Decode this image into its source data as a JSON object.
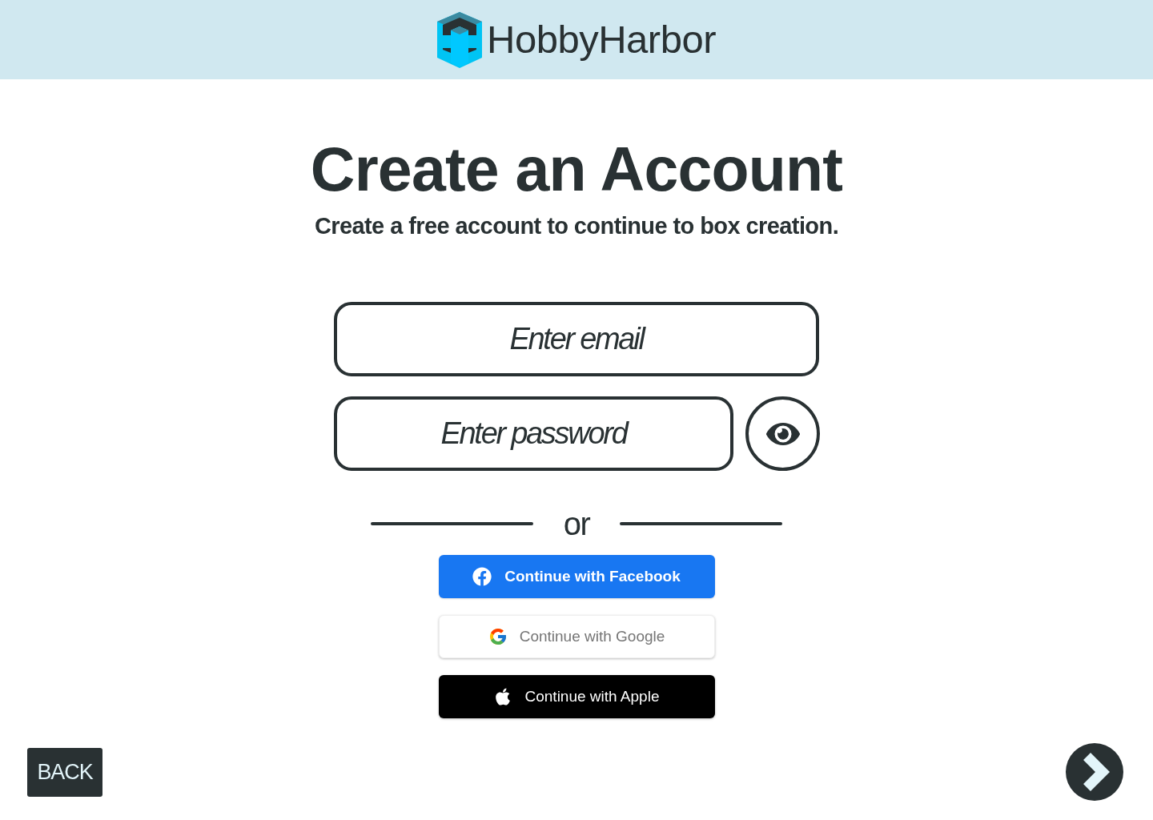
{
  "header": {
    "logo_text": "HobbyHarbor"
  },
  "heading": "Create an Account",
  "subheading": "Create a free account to continue to box creation.",
  "form": {
    "email": {
      "placeholder": "Enter email"
    },
    "password": {
      "placeholder": "Enter password"
    }
  },
  "divider": {
    "text": "or"
  },
  "social_buttons": [
    {
      "kind": "facebook",
      "label": "Continue with Facebook"
    },
    {
      "kind": "google",
      "label": "Continue with Google"
    },
    {
      "kind": "apple",
      "label": "Continue with Apple"
    }
  ],
  "navigation": {
    "back_label": "BACK"
  }
}
